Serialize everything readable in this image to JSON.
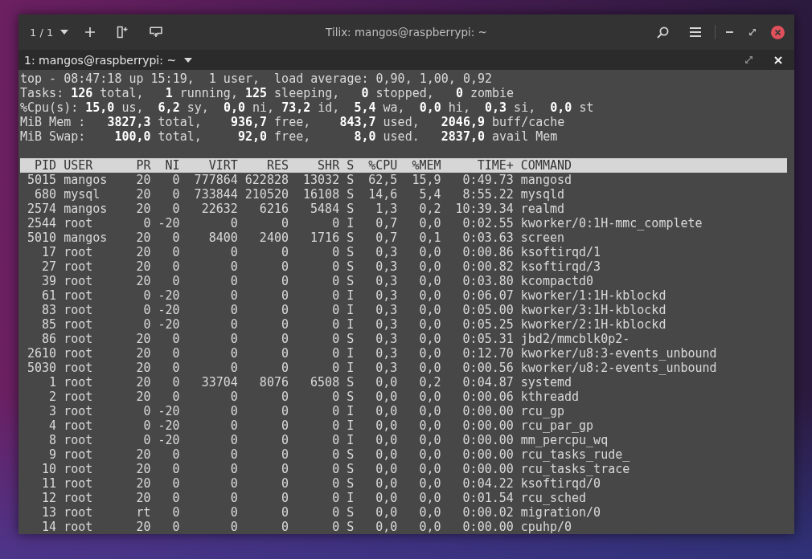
{
  "window": {
    "session_switcher": "1 / 1",
    "title": "Tilix: mangos@raspberrypi: ~"
  },
  "terminal": {
    "title": "1: mangos@raspberrypi: ~",
    "summary": [
      "top - 08:47:18 up 15:19,  1 user,  load average: 0,90, 1,00, 0,92",
      "Tasks: **126** total,   **1** running, **125** sleeping,   **0** stopped,   **0** zombie",
      "%Cpu(s): **15,0** us,  **6,2** sy,  **0,0** ni, **73,2** id,  **5,4** wa,  **0,0** hi,  **0,3** si,  **0,0** st",
      "MiB Mem :   **3827,3** total,    **936,7** free,    **843,7** used,   **2046,9** buff/cache",
      "MiB Swap:    **100,0** total,     **92,0** free,      **8,0** used.   **2837,0** avail Mem"
    ],
    "process_table": {
      "columns": [
        "PID",
        "USER",
        "PR",
        "NI",
        "VIRT",
        "RES",
        "SHR",
        "S",
        "%CPU",
        "%MEM",
        "TIME+",
        "COMMAND"
      ],
      "rows": [
        [
          "5015",
          "mangos",
          "20",
          "0",
          "777864",
          "622828",
          "13032",
          "S",
          "62,5",
          "15,9",
          "0:49.73",
          "mangosd"
        ],
        [
          "680",
          "mysql",
          "20",
          "0",
          "733844",
          "210520",
          "16108",
          "S",
          "14,6",
          "5,4",
          "8:55.22",
          "mysqld"
        ],
        [
          "2574",
          "mangos",
          "20",
          "0",
          "22632",
          "6216",
          "5484",
          "S",
          "1,3",
          "0,2",
          "10:39.34",
          "realmd"
        ],
        [
          "2544",
          "root",
          "0",
          "-20",
          "0",
          "0",
          "0",
          "I",
          "0,7",
          "0,0",
          "0:02.55",
          "kworker/0:1H-mmc_complete"
        ],
        [
          "5010",
          "mangos",
          "20",
          "0",
          "8400",
          "2400",
          "1716",
          "S",
          "0,7",
          "0,1",
          "0:03.63",
          "screen"
        ],
        [
          "17",
          "root",
          "20",
          "0",
          "0",
          "0",
          "0",
          "S",
          "0,3",
          "0,0",
          "0:00.86",
          "ksoftirqd/1"
        ],
        [
          "27",
          "root",
          "20",
          "0",
          "0",
          "0",
          "0",
          "S",
          "0,3",
          "0,0",
          "0:00.82",
          "ksoftirqd/3"
        ],
        [
          "39",
          "root",
          "20",
          "0",
          "0",
          "0",
          "0",
          "S",
          "0,3",
          "0,0",
          "0:03.80",
          "kcompactd0"
        ],
        [
          "61",
          "root",
          "0",
          "-20",
          "0",
          "0",
          "0",
          "I",
          "0,3",
          "0,0",
          "0:06.07",
          "kworker/1:1H-kblockd"
        ],
        [
          "83",
          "root",
          "0",
          "-20",
          "0",
          "0",
          "0",
          "I",
          "0,3",
          "0,0",
          "0:05.00",
          "kworker/3:1H-kblockd"
        ],
        [
          "85",
          "root",
          "0",
          "-20",
          "0",
          "0",
          "0",
          "I",
          "0,3",
          "0,0",
          "0:05.25",
          "kworker/2:1H-kblockd"
        ],
        [
          "86",
          "root",
          "20",
          "0",
          "0",
          "0",
          "0",
          "S",
          "0,3",
          "0,0",
          "0:05.31",
          "jbd2/mmcblk0p2-"
        ],
        [
          "2610",
          "root",
          "20",
          "0",
          "0",
          "0",
          "0",
          "I",
          "0,3",
          "0,0",
          "0:12.70",
          "kworker/u8:3-events_unbound"
        ],
        [
          "5030",
          "root",
          "20",
          "0",
          "0",
          "0",
          "0",
          "I",
          "0,3",
          "0,0",
          "0:00.56",
          "kworker/u8:2-events_unbound"
        ],
        [
          "1",
          "root",
          "20",
          "0",
          "33704",
          "8076",
          "6508",
          "S",
          "0,0",
          "0,2",
          "0:04.87",
          "systemd"
        ],
        [
          "2",
          "root",
          "20",
          "0",
          "0",
          "0",
          "0",
          "S",
          "0,0",
          "0,0",
          "0:00.06",
          "kthreadd"
        ],
        [
          "3",
          "root",
          "0",
          "-20",
          "0",
          "0",
          "0",
          "I",
          "0,0",
          "0,0",
          "0:00.00",
          "rcu_gp"
        ],
        [
          "4",
          "root",
          "0",
          "-20",
          "0",
          "0",
          "0",
          "I",
          "0,0",
          "0,0",
          "0:00.00",
          "rcu_par_gp"
        ],
        [
          "8",
          "root",
          "0",
          "-20",
          "0",
          "0",
          "0",
          "I",
          "0,0",
          "0,0",
          "0:00.00",
          "mm_percpu_wq"
        ],
        [
          "9",
          "root",
          "20",
          "0",
          "0",
          "0",
          "0",
          "S",
          "0,0",
          "0,0",
          "0:00.00",
          "rcu_tasks_rude_"
        ],
        [
          "10",
          "root",
          "20",
          "0",
          "0",
          "0",
          "0",
          "S",
          "0,0",
          "0,0",
          "0:00.00",
          "rcu_tasks_trace"
        ],
        [
          "11",
          "root",
          "20",
          "0",
          "0",
          "0",
          "0",
          "S",
          "0,0",
          "0,0",
          "0:04.22",
          "ksoftirqd/0"
        ],
        [
          "12",
          "root",
          "20",
          "0",
          "0",
          "0",
          "0",
          "I",
          "0,0",
          "0,0",
          "0:01.54",
          "rcu_sched"
        ],
        [
          "13",
          "root",
          "rt",
          "0",
          "0",
          "0",
          "0",
          "S",
          "0,0",
          "0,0",
          "0:00.02",
          "migration/0"
        ],
        [
          "14",
          "root",
          "20",
          "0",
          "0",
          "0",
          "0",
          "S",
          "0,0",
          "0,0",
          "0:00.00",
          "cpuhp/0"
        ]
      ]
    }
  }
}
